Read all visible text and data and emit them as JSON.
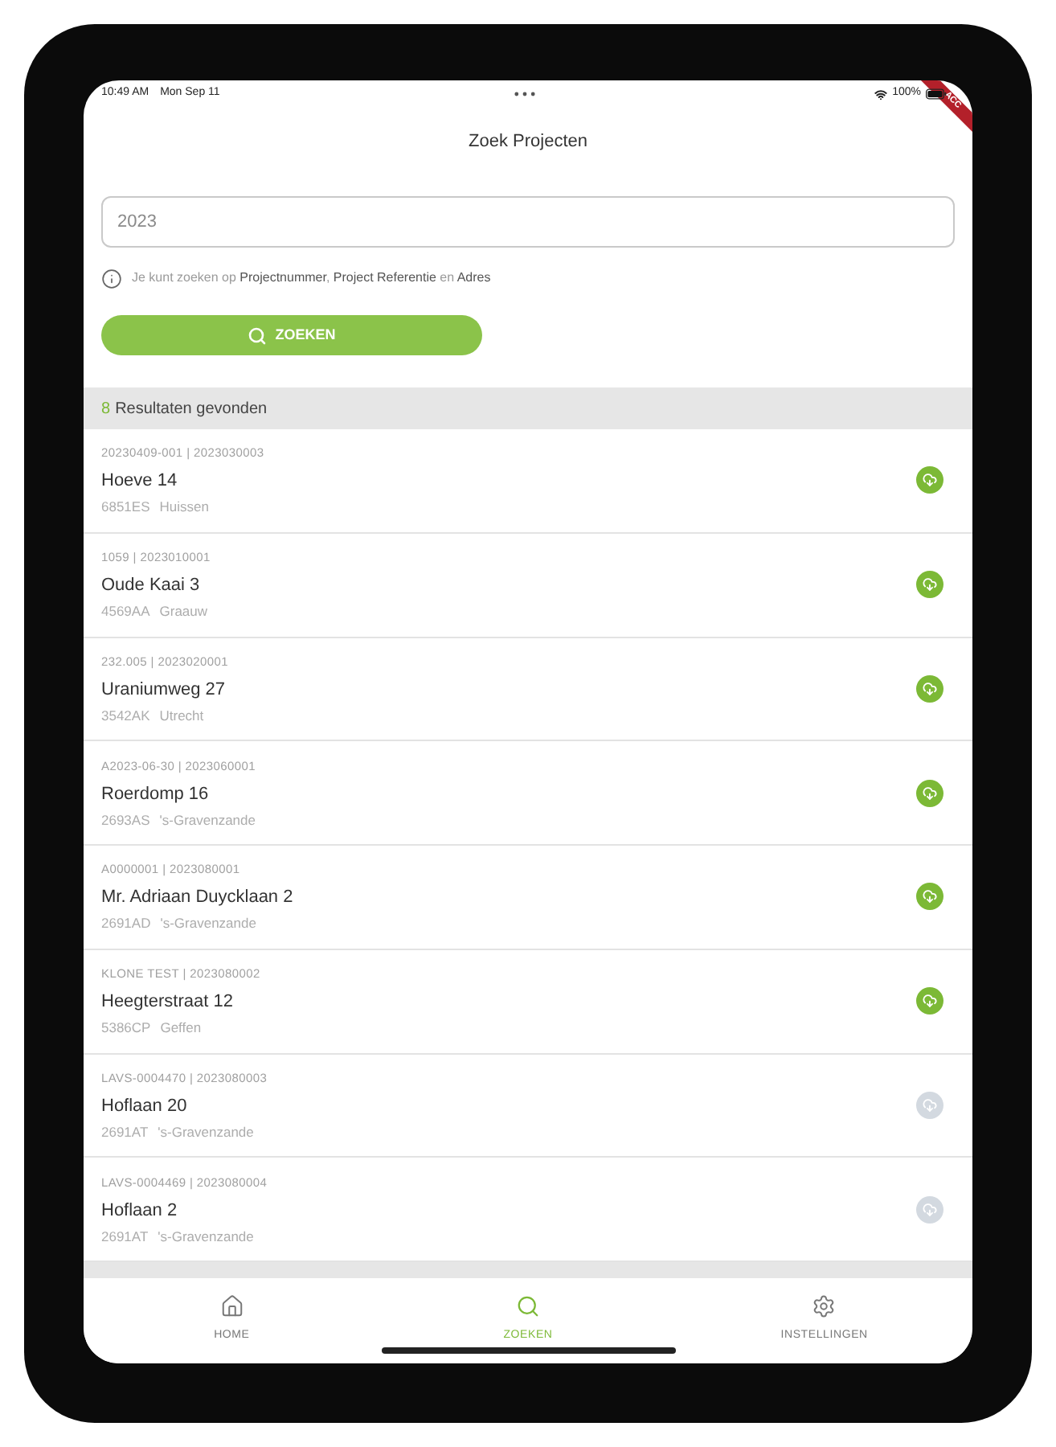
{
  "status_bar": {
    "time": "10:49 AM",
    "date": "Mon Sep 11",
    "battery": "100%"
  },
  "banner": {
    "label": "ACC"
  },
  "header": {
    "title": "Zoek Projecten"
  },
  "search": {
    "value": "2023",
    "hint": "Je kunt zoeken op **Projectnummer**, **Project Referentie** en **Adres**",
    "button": "ZOEKEN"
  },
  "results": {
    "count": "8",
    "label": "Resultaten gevonden",
    "items": [
      {
        "ids": "20230409-001 | 2023030003",
        "name": "Hoeve 14",
        "postcode": "6851ES",
        "city": "Huissen",
        "synced": true
      },
      {
        "ids": "1059 | 2023010001",
        "name": "Oude Kaai 3",
        "postcode": "4569AA",
        "city": "Graauw",
        "synced": true
      },
      {
        "ids": "232.005 | 2023020001",
        "name": "Uraniumweg 27",
        "postcode": "3542AK",
        "city": "Utrecht",
        "synced": true
      },
      {
        "ids": "A2023-06-30 | 2023060001",
        "name": "Roerdomp 16",
        "postcode": "2693AS",
        "city": "'s-Gravenzande",
        "synced": true
      },
      {
        "ids": "A0000001 | 2023080001",
        "name": "Mr. Adriaan Duycklaan 2",
        "postcode": "2691AD",
        "city": "'s-Gravenzande",
        "synced": true
      },
      {
        "ids": "KLONE TEST | 2023080002",
        "name": "Heegterstraat 12",
        "postcode": "5386CP",
        "city": "Geffen",
        "synced": true
      },
      {
        "ids": "LAVS-0004470 | 2023080003",
        "name": "Hoflaan 20",
        "postcode": "2691AT",
        "city": "'s-Gravenzande",
        "synced": false
      },
      {
        "ids": "LAVS-0004469 | 2023080004",
        "name": "Hoflaan 2",
        "postcode": "2691AT",
        "city": "'s-Gravenzande",
        "synced": false
      }
    ]
  },
  "tab_bar": [
    {
      "label": "HOME",
      "selected": false
    },
    {
      "label": "ZOEKEN",
      "selected": true
    },
    {
      "label": "INSTELLINGEN",
      "selected": false
    }
  ]
}
